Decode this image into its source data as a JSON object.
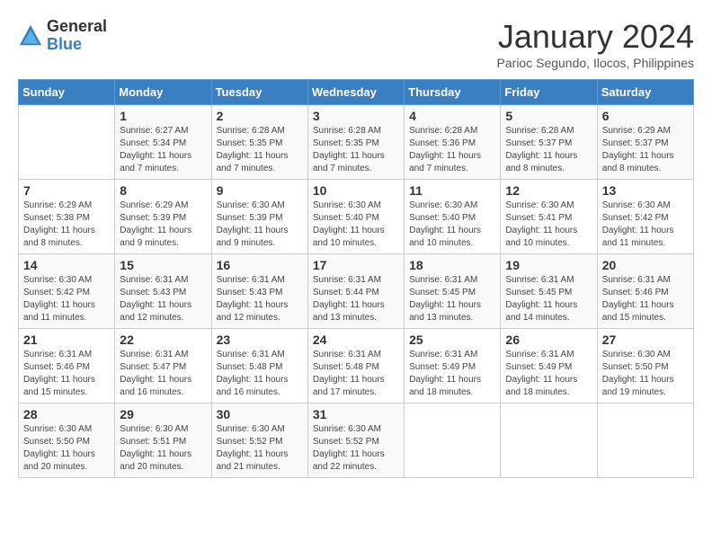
{
  "logo": {
    "general": "General",
    "blue": "Blue"
  },
  "title": "January 2024",
  "subtitle": "Parioc Segundo, Ilocos, Philippines",
  "days_of_week": [
    "Sunday",
    "Monday",
    "Tuesday",
    "Wednesday",
    "Thursday",
    "Friday",
    "Saturday"
  ],
  "weeks": [
    [
      {
        "day": "",
        "info": ""
      },
      {
        "day": "1",
        "info": "Sunrise: 6:27 AM\nSunset: 5:34 PM\nDaylight: 11 hours\nand 7 minutes."
      },
      {
        "day": "2",
        "info": "Sunrise: 6:28 AM\nSunset: 5:35 PM\nDaylight: 11 hours\nand 7 minutes."
      },
      {
        "day": "3",
        "info": "Sunrise: 6:28 AM\nSunset: 5:35 PM\nDaylight: 11 hours\nand 7 minutes."
      },
      {
        "day": "4",
        "info": "Sunrise: 6:28 AM\nSunset: 5:36 PM\nDaylight: 11 hours\nand 7 minutes."
      },
      {
        "day": "5",
        "info": "Sunrise: 6:28 AM\nSunset: 5:37 PM\nDaylight: 11 hours\nand 8 minutes."
      },
      {
        "day": "6",
        "info": "Sunrise: 6:29 AM\nSunset: 5:37 PM\nDaylight: 11 hours\nand 8 minutes."
      }
    ],
    [
      {
        "day": "7",
        "info": "Sunrise: 6:29 AM\nSunset: 5:38 PM\nDaylight: 11 hours\nand 8 minutes."
      },
      {
        "day": "8",
        "info": "Sunrise: 6:29 AM\nSunset: 5:39 PM\nDaylight: 11 hours\nand 9 minutes."
      },
      {
        "day": "9",
        "info": "Sunrise: 6:30 AM\nSunset: 5:39 PM\nDaylight: 11 hours\nand 9 minutes."
      },
      {
        "day": "10",
        "info": "Sunrise: 6:30 AM\nSunset: 5:40 PM\nDaylight: 11 hours\nand 10 minutes."
      },
      {
        "day": "11",
        "info": "Sunrise: 6:30 AM\nSunset: 5:40 PM\nDaylight: 11 hours\nand 10 minutes."
      },
      {
        "day": "12",
        "info": "Sunrise: 6:30 AM\nSunset: 5:41 PM\nDaylight: 11 hours\nand 10 minutes."
      },
      {
        "day": "13",
        "info": "Sunrise: 6:30 AM\nSunset: 5:42 PM\nDaylight: 11 hours\nand 11 minutes."
      }
    ],
    [
      {
        "day": "14",
        "info": "Sunrise: 6:30 AM\nSunset: 5:42 PM\nDaylight: 11 hours\nand 11 minutes."
      },
      {
        "day": "15",
        "info": "Sunrise: 6:31 AM\nSunset: 5:43 PM\nDaylight: 11 hours\nand 12 minutes."
      },
      {
        "day": "16",
        "info": "Sunrise: 6:31 AM\nSunset: 5:43 PM\nDaylight: 11 hours\nand 12 minutes."
      },
      {
        "day": "17",
        "info": "Sunrise: 6:31 AM\nSunset: 5:44 PM\nDaylight: 11 hours\nand 13 minutes."
      },
      {
        "day": "18",
        "info": "Sunrise: 6:31 AM\nSunset: 5:45 PM\nDaylight: 11 hours\nand 13 minutes."
      },
      {
        "day": "19",
        "info": "Sunrise: 6:31 AM\nSunset: 5:45 PM\nDaylight: 11 hours\nand 14 minutes."
      },
      {
        "day": "20",
        "info": "Sunrise: 6:31 AM\nSunset: 5:46 PM\nDaylight: 11 hours\nand 15 minutes."
      }
    ],
    [
      {
        "day": "21",
        "info": "Sunrise: 6:31 AM\nSunset: 5:46 PM\nDaylight: 11 hours\nand 15 minutes."
      },
      {
        "day": "22",
        "info": "Sunrise: 6:31 AM\nSunset: 5:47 PM\nDaylight: 11 hours\nand 16 minutes."
      },
      {
        "day": "23",
        "info": "Sunrise: 6:31 AM\nSunset: 5:48 PM\nDaylight: 11 hours\nand 16 minutes."
      },
      {
        "day": "24",
        "info": "Sunrise: 6:31 AM\nSunset: 5:48 PM\nDaylight: 11 hours\nand 17 minutes."
      },
      {
        "day": "25",
        "info": "Sunrise: 6:31 AM\nSunset: 5:49 PM\nDaylight: 11 hours\nand 18 minutes."
      },
      {
        "day": "26",
        "info": "Sunrise: 6:31 AM\nSunset: 5:49 PM\nDaylight: 11 hours\nand 18 minutes."
      },
      {
        "day": "27",
        "info": "Sunrise: 6:30 AM\nSunset: 5:50 PM\nDaylight: 11 hours\nand 19 minutes."
      }
    ],
    [
      {
        "day": "28",
        "info": "Sunrise: 6:30 AM\nSunset: 5:50 PM\nDaylight: 11 hours\nand 20 minutes."
      },
      {
        "day": "29",
        "info": "Sunrise: 6:30 AM\nSunset: 5:51 PM\nDaylight: 11 hours\nand 20 minutes."
      },
      {
        "day": "30",
        "info": "Sunrise: 6:30 AM\nSunset: 5:52 PM\nDaylight: 11 hours\nand 21 minutes."
      },
      {
        "day": "31",
        "info": "Sunrise: 6:30 AM\nSunset: 5:52 PM\nDaylight: 11 hours\nand 22 minutes."
      },
      {
        "day": "",
        "info": ""
      },
      {
        "day": "",
        "info": ""
      },
      {
        "day": "",
        "info": ""
      }
    ]
  ]
}
